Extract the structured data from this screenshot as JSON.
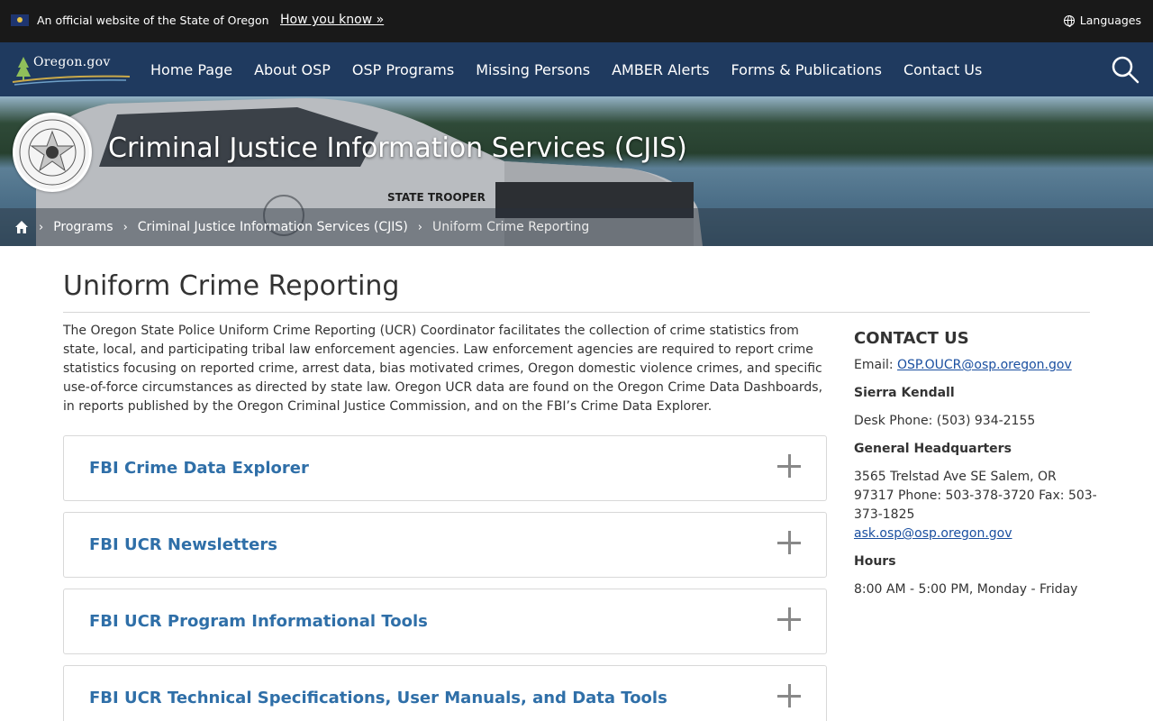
{
  "banner": {
    "official_text": "An official website of the State of Oregon",
    "how_link": "How you know »",
    "languages_label": "Languages"
  },
  "nav": {
    "logo_text": "Oregon.gov",
    "items": [
      {
        "label": "Home Page"
      },
      {
        "label": "About OSP"
      },
      {
        "label": "OSP Programs"
      },
      {
        "label": "Missing Persons"
      },
      {
        "label": "AMBER Alerts"
      },
      {
        "label": "Forms & Publications"
      },
      {
        "label": "Contact Us"
      }
    ],
    "search_icon": "search-icon"
  },
  "hero": {
    "title": "Criminal Justice Information Services (CJIS)",
    "vehicle_text": "STATE TROOPER",
    "breadcrumb": [
      {
        "label": "Programs"
      },
      {
        "label": "Criminal Justice Information Services (CJIS)"
      },
      {
        "label": "Uniform Crime Reporting"
      }
    ]
  },
  "main": {
    "title": "Uniform Crime Reporting",
    "intro": "The Oregon State Police Uniform Crime Reporting (UCR) Coordinator facilitates the collection of crime statistics from state, local, and participating tribal law enforcement agencies. Law enforcement agencies are required to report crime statistics focusing on reported crime, arrest data, bias motivated crimes, Oregon domestic violence crimes, and specific use-of-force circumstances as directed by state law. Oregon UCR data are found on the Oregon Crime Data Dashboards, in reports published by the Oregon Criminal Justice Commission, and on the FBI’s Crime Data Explorer.",
    "accordions": [
      {
        "label": "FBI Crime Data Explorer"
      },
      {
        "label": "FBI UCR Newsletters"
      },
      {
        "label": "FBI UCR Program Informational Tools"
      },
      {
        "label": "FBI UCR Technical Specifications, User Manuals, and Data Tools"
      }
    ]
  },
  "sidebar": {
    "heading": "CONTACT US",
    "email_label": "Email: ",
    "email": "OSP.OUCR@osp.oregon.gov",
    "contact_name": "Sierra Kendall",
    "desk_phone": "Desk Phone: (503) 934-2155",
    "hq_heading": "General Headquarters",
    "hq_address": "3565 Trelstad Ave SE Salem, OR 97317 Phone: 503-378-3720 Fax: 503-373-1825",
    "hq_email": "ask.osp@osp.oregon.gov",
    "hours_heading": "Hours",
    "hours": "8:00 AM - 5:00 PM, Monday - Friday"
  },
  "colors": {
    "nav_bg": "#1f3a5f",
    "banner_bg": "#191919",
    "accordion_text": "#2f6fa8",
    "link": "#1a4fa0"
  }
}
